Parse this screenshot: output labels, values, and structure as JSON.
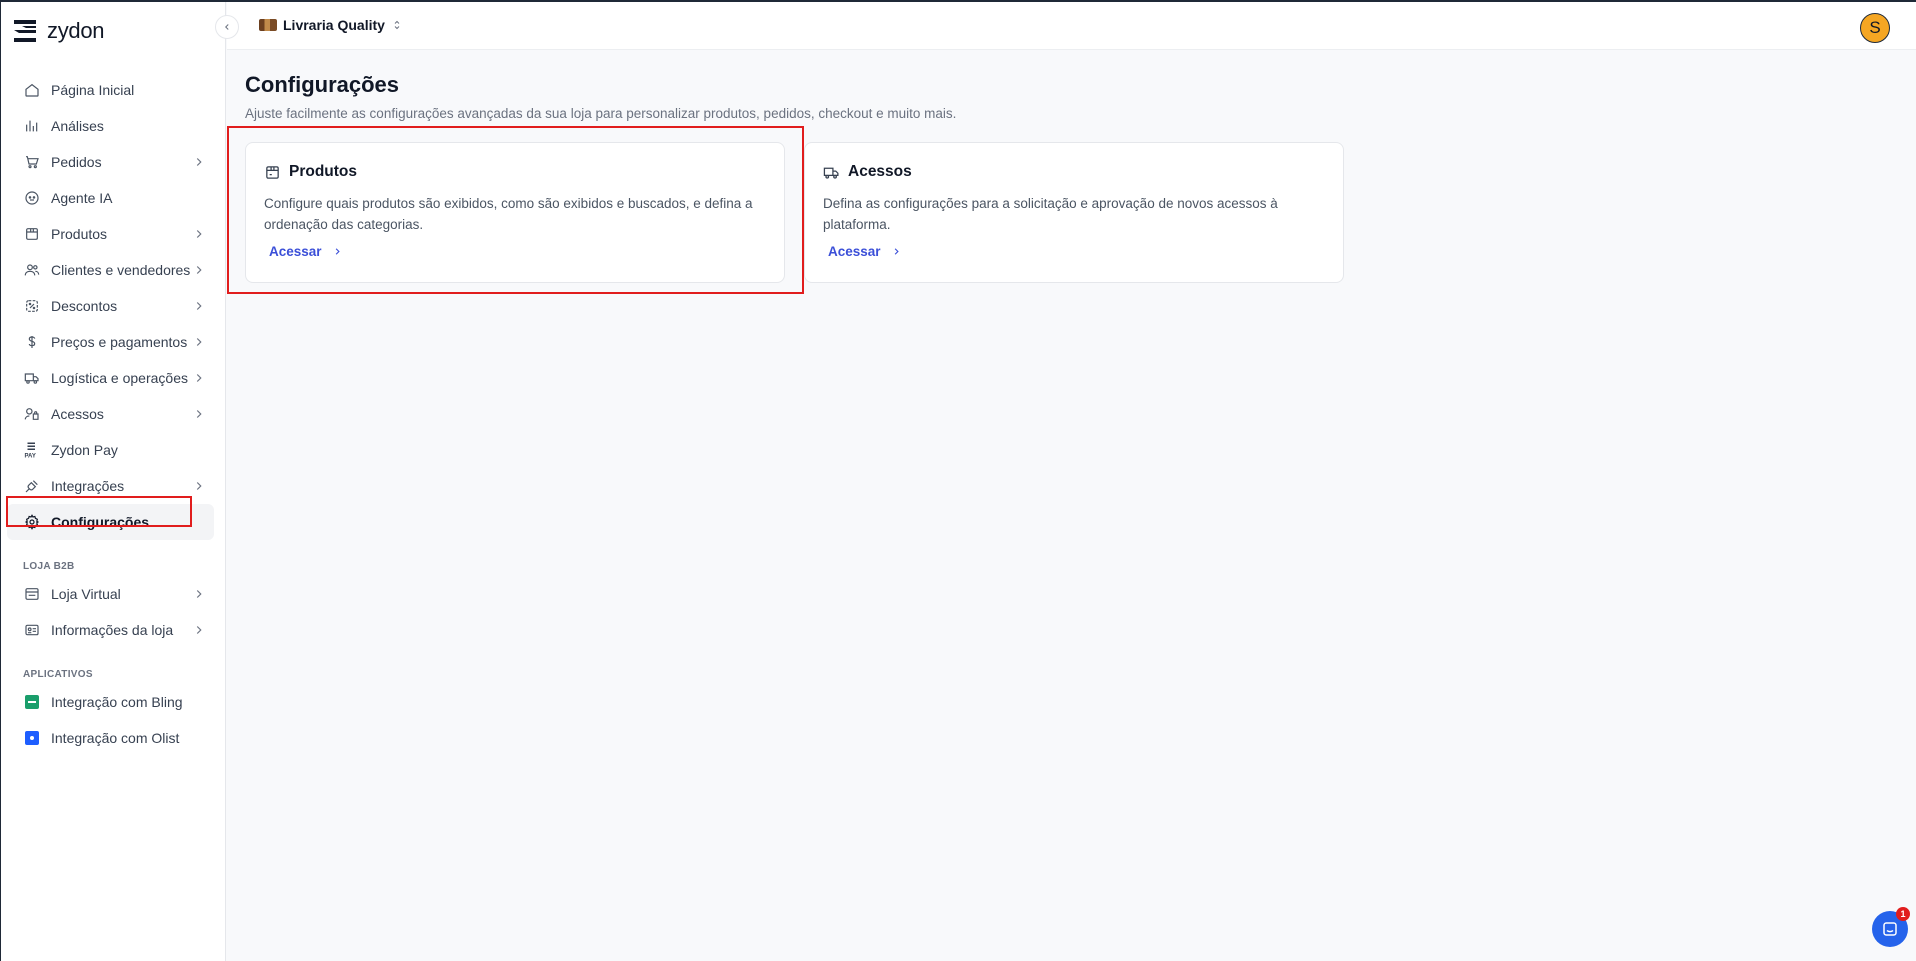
{
  "brand": {
    "name": "zydon"
  },
  "topbar": {
    "store_name": "Livraria Quality",
    "avatar_initial": "S"
  },
  "sidebar": {
    "items": [
      {
        "label": "Página Inicial",
        "icon": "home-icon",
        "has_children": false
      },
      {
        "label": "Análises",
        "icon": "bar-chart-icon",
        "has_children": false
      },
      {
        "label": "Pedidos",
        "icon": "cart-icon",
        "has_children": true
      },
      {
        "label": "Agente IA",
        "icon": "ai-agent-icon",
        "has_children": false
      },
      {
        "label": "Produtos",
        "icon": "package-icon",
        "has_children": true
      },
      {
        "label": "Clientes e vendedores",
        "icon": "users-icon",
        "has_children": true
      },
      {
        "label": "Descontos",
        "icon": "discount-icon",
        "has_children": true
      },
      {
        "label": "Preços e pagamentos",
        "icon": "dollar-icon",
        "has_children": true
      },
      {
        "label": "Logística e operações",
        "icon": "truck-icon",
        "has_children": true
      },
      {
        "label": "Acessos",
        "icon": "access-icon",
        "has_children": true
      },
      {
        "label": "Zydon Pay",
        "icon": "zydon-pay-icon",
        "has_children": false
      },
      {
        "label": "Integrações",
        "icon": "plug-icon",
        "has_children": true
      },
      {
        "label": "Configurações",
        "icon": "gear-icon",
        "has_children": false,
        "active": true
      }
    ],
    "section_b2b": "LOJA B2B",
    "b2b_items": [
      {
        "label": "Loja Virtual",
        "icon": "store-icon",
        "has_children": true
      },
      {
        "label": "Informações da loja",
        "icon": "info-card-icon",
        "has_children": true
      }
    ],
    "section_apps": "APLICATIVOS",
    "app_items": [
      {
        "label": "Integração com Bling",
        "icon": "bling-app-icon",
        "color": "#1a9e6b"
      },
      {
        "label": "Integração com Olist",
        "icon": "olist-app-icon",
        "color": "#1e5eff"
      }
    ]
  },
  "main": {
    "title": "Configurações",
    "subtitle": "Ajuste facilmente as configurações avançadas da sua loja para personalizar produtos, pedidos, checkout e muito mais.",
    "cards": [
      {
        "title": "Produtos",
        "icon": "package-icon",
        "description": "Configure quais produtos são exibidos, como são exibidos e buscados, e defina a ordenação das categorias.",
        "link": "Acessar"
      },
      {
        "title": "Acessos",
        "icon": "truck-access-icon",
        "description": "Defina as configurações para a solicitação e aprovação de novos acessos à plataforma.",
        "link": "Acessar"
      }
    ]
  },
  "chat": {
    "badge": "1"
  },
  "colors": {
    "accent": "#3b4fd8",
    "highlight": "#e11d1d",
    "avatar": "#f5a623"
  }
}
